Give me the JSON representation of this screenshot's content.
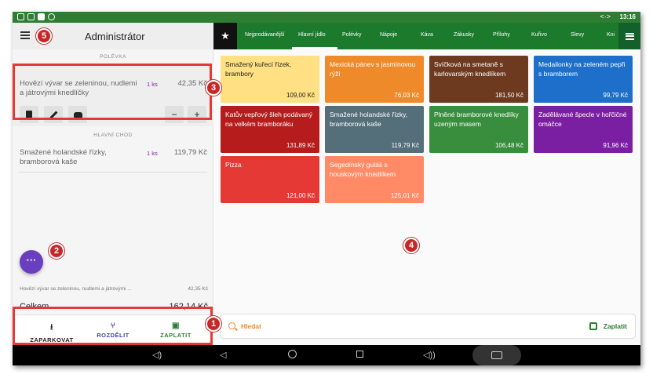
{
  "status_bar": {
    "time": "13:16",
    "arrows": "<·>"
  },
  "left_panel": {
    "title": "Administrátor",
    "sections": [
      {
        "label": "POLÉVKA"
      },
      {
        "label": "HLAVNÍ CHOD"
      }
    ],
    "order_items": [
      {
        "name": "Hovězí vývar se zeleninou, nudlemi a játrovými knedlíčky",
        "qty": "1 ks",
        "price": "42,35 Kč"
      },
      {
        "name": "Smažené holandské řízky, bramborová kaše",
        "qty": "1 ks",
        "price": "119,79 Kč"
      }
    ],
    "item_buttons": {
      "minus": "−",
      "plus": "+"
    },
    "fab_label": "···",
    "summary": {
      "last_item": "Hovězí vývar se zeleninou, nudlemi a játrovými ...",
      "last_amount": "42,35 Kč"
    },
    "total": {
      "label": "Celkem",
      "amount": "162,14 Kč"
    },
    "actions": {
      "park": "ZAPARKOVAT",
      "split": "ROZDĚLIT",
      "pay": "ZAPLATIT"
    }
  },
  "categories": {
    "star_icon": "★",
    "tabs": [
      "Nejprodávanější",
      "Hlavní jídlo",
      "Polévky",
      "Nápoje",
      "Káva",
      "Zákusky",
      "Přílohy",
      "Kuřivo",
      "Slevy",
      "Kni"
    ],
    "active_index": 1
  },
  "products": [
    {
      "name": "Smažený kuřecí řízek, brambory",
      "price": "109,00 Kč",
      "color": "#ffe082"
    },
    {
      "name": "Mexická pánev s jasmínovou rýží",
      "price": "76,03 Kč",
      "color": "#ef8a2b"
    },
    {
      "name": "Svíčková na smetaně s karlovarským knedlíkem",
      "price": "181,50 Kč",
      "color": "#6d3a1f"
    },
    {
      "name": "Medailonky na zeleném pepři s bramborem",
      "price": "99,79 Kč",
      "color": "#1e6fc9"
    },
    {
      "name": "Katův vepřový šleh podávaný na velkém bramboráku",
      "price": "131,89 Kč",
      "color": "#b71c1c"
    },
    {
      "name": "Smažené holandské řízky, bramborová kaše",
      "price": "119,79 Kč",
      "color": "#546e7a"
    },
    {
      "name": "Plněné bramborové knedlíky uzeným masem",
      "price": "106,48 Kč",
      "color": "#388e3c"
    },
    {
      "name": "Zadělávané špecle v hořčičné omáčce",
      "price": "91,96 Kč",
      "color": "#7b1fa2"
    },
    {
      "name": "Pizza",
      "price": "121,00 Kč",
      "color": "#e53935"
    },
    {
      "name": "Segedínský guláš s houskovým knedlíkem",
      "price": "125,01 Kč",
      "color": "#ff8a65"
    }
  ],
  "search": {
    "label": "Hledat",
    "pay_label": "Zaplatit"
  },
  "annotations": [
    "1",
    "2",
    "3",
    "4",
    "5"
  ],
  "colors": {
    "brand_green": "#1b7a2b",
    "accent_orange": "#ef8a2b",
    "highlight_red": "#e53935",
    "fab_purple": "#6a3fbf"
  }
}
